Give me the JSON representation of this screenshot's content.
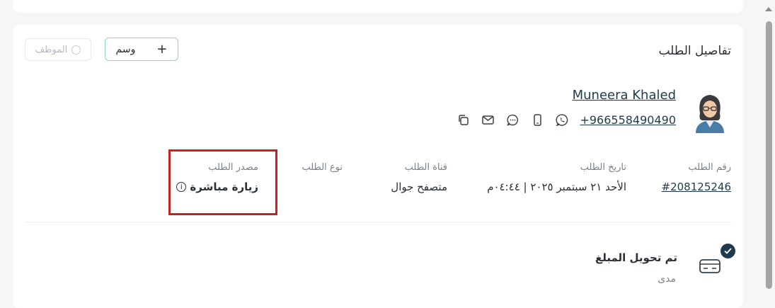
{
  "header": {
    "title": "تفاصيل الطلب",
    "tag_button_label": "وسم",
    "staff_button_label": "الموظف"
  },
  "customer": {
    "name": "Muneera Khaled",
    "phone": "+966558490490"
  },
  "order_fields": {
    "order_number_label": "رقم الطلب",
    "order_number": "#208125246",
    "order_date_label": "تاريخ الطلب",
    "order_date": "الأحد ٢١ سبتمبر ٢٠٢٥ | ٠٤:٤٤م",
    "channel_label": "قناة الطلب",
    "channel": "متصفح جوال",
    "type_label": "نوع الطلب",
    "type": "",
    "source_label": "مصدر الطلب",
    "source": "زيارة مباشرة"
  },
  "payment": {
    "status": "تم تحويل المبلغ",
    "method": "مدى"
  },
  "colors": {
    "accent": "#1e3a4c",
    "highlight": "#cc1f1f",
    "tag_border": "#8fd2c9"
  }
}
